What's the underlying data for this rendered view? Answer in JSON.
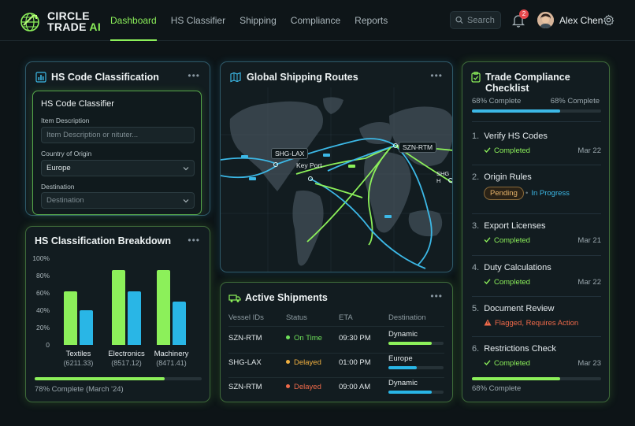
{
  "brand": {
    "line1": "CIRCLE",
    "line2": "TRADE",
    "ai": "AI"
  },
  "nav": [
    {
      "label": "Dashboard",
      "active": true
    },
    {
      "label": "HS Classifier"
    },
    {
      "label": "Shipping"
    },
    {
      "label": "Compliance"
    },
    {
      "label": "Reports"
    }
  ],
  "search": {
    "placeholder": "Search"
  },
  "notifications": {
    "count": "2"
  },
  "user": {
    "name": "Alex Chen"
  },
  "hs_card": {
    "title": "HS Code Classification",
    "inner_title": "HS Code Classifier",
    "item_label": "Item Description",
    "item_placeholder": "Item Description or nituter...",
    "origin_label": "Country of Origin",
    "origin_value": "Europe",
    "destination_label": "Destination",
    "destination_placeholder": "Destination"
  },
  "breakdown": {
    "title": "HS Classification Breakdown",
    "footer": "78% Complete (March '24)",
    "progress": 0.78
  },
  "chart_data": {
    "type": "bar",
    "title": "HS Classification Breakdown",
    "categories": [
      "Textiles",
      "Electronics",
      "Machinery"
    ],
    "category_values": [
      "(6211.33)",
      "(8517.12)",
      "(8471.41)"
    ],
    "series": [
      {
        "values": [
          62,
          86,
          86
        ],
        "color": "#8cf05a"
      },
      {
        "values": [
          40,
          62,
          50
        ],
        "color": "#29b6e6"
      }
    ],
    "yticks": [
      "100%",
      "80%",
      "60%",
      "40%",
      "20%",
      "0"
    ],
    "ylim": [
      0,
      100
    ],
    "grid": false
  },
  "routes": {
    "title": "Global Shipping Routes",
    "labels": {
      "shg_lax": "SHG-LAX",
      "key_port": "Key Port",
      "szn_rtm": "SZN-RTM",
      "shg_edge": "SHG H"
    }
  },
  "shipments": {
    "title": "Active Shipments",
    "headers": [
      "Vessel IDs",
      "Status",
      "ETA",
      "Destination"
    ],
    "rows": [
      {
        "id": "SZN-RTM",
        "status": "On Time",
        "status_color": "#6fe05a",
        "eta": "09:30 PM",
        "dest": "Dynamic",
        "progress": 0.78,
        "bar_color": "#8cf05a"
      },
      {
        "id": "SHG-LAX",
        "status": "Delayed",
        "status_color": "#f0b040",
        "eta": "01:00 PM",
        "dest": "Europe",
        "progress": 0.52,
        "bar_color": "#29b6e6"
      },
      {
        "id": "SZN-RTM",
        "status": "Delayed",
        "status_color": "#ee6a4a",
        "eta": "09:00 AM",
        "dest": "Dynamic",
        "progress": 0.78,
        "bar_color": "#29b6e6"
      }
    ]
  },
  "checklist": {
    "title": "Trade Compliance Checklist",
    "top_left": "68% Complete",
    "top_right": "68% Complete",
    "top_progress": 0.68,
    "items": [
      {
        "num": "1.",
        "title": "Verify HS Codes",
        "status": "Completed",
        "date": "Mar 22"
      },
      {
        "num": "2.",
        "title": "Origin Rules",
        "pill": "Pending",
        "status": "In Progress",
        "date": ""
      },
      {
        "num": "3.",
        "title": "Export Licenses",
        "status": "Completed",
        "date": "Mar 21"
      },
      {
        "num": "4.",
        "title": "Duty Calculations",
        "status": "Completed",
        "date": "Mar 22"
      },
      {
        "num": "5.",
        "title": "Document Review",
        "status": "Flagged, Requires Action",
        "date": ""
      },
      {
        "num": "6.",
        "title": "Restrictions Check",
        "status": "Completed",
        "date": "Mar 23"
      }
    ],
    "bottom_note": "68% Complete",
    "bottom_progress": 0.68
  }
}
